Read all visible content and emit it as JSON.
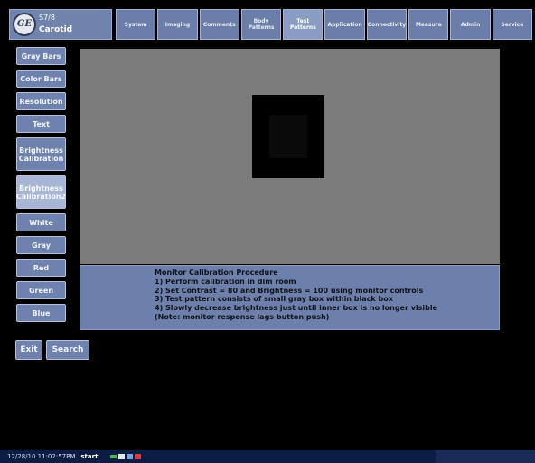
{
  "header": {
    "logo_text": "GE",
    "model": "S7/8",
    "preset": "Carotid"
  },
  "topbar": {
    "buttons": [
      {
        "label": "System"
      },
      {
        "label": "Imaging"
      },
      {
        "label": "Comments"
      },
      {
        "label": "Body\nPatterns"
      },
      {
        "label": "Test\nPatterns"
      },
      {
        "label": "Application"
      },
      {
        "label": "Connectivity"
      },
      {
        "label": "Measure"
      },
      {
        "label": "Admin"
      },
      {
        "label": "Service"
      }
    ],
    "active_index": 4
  },
  "sidebar": {
    "buttons": [
      {
        "label": "Gray Bars"
      },
      {
        "label": "Color Bars"
      },
      {
        "label": "Resolution"
      },
      {
        "label": "Text"
      },
      {
        "label": "Brightness\nCalibration"
      },
      {
        "label": "Brightness\nCalibration2"
      },
      {
        "label": "White"
      },
      {
        "label": "Gray"
      },
      {
        "label": "Red"
      },
      {
        "label": "Green"
      },
      {
        "label": "Blue"
      }
    ],
    "selected_index": 5
  },
  "info": {
    "lines": [
      "Monitor Calibration Procedure",
      "1) Perform calibration in dim room",
      "2) Set Contrast = 80 and Brightness = 100 using monitor controls",
      "3) Test pattern consists of small gray box within black box",
      "4) Slowly decrease brightness just until inner box is no longer visible",
      "(Note: monitor response lags button push)"
    ]
  },
  "actions": {
    "exit_label": "Exit",
    "search_label": "Search"
  },
  "taskbar": {
    "datetime": "12/28/10 11:02:57PM",
    "start_label": "start"
  },
  "colors": {
    "button_blue": "#6f82ad",
    "selected_blue": "#a8b6d6",
    "display_gray": "#7b7b7b",
    "taskbar": "#0b1d44"
  }
}
